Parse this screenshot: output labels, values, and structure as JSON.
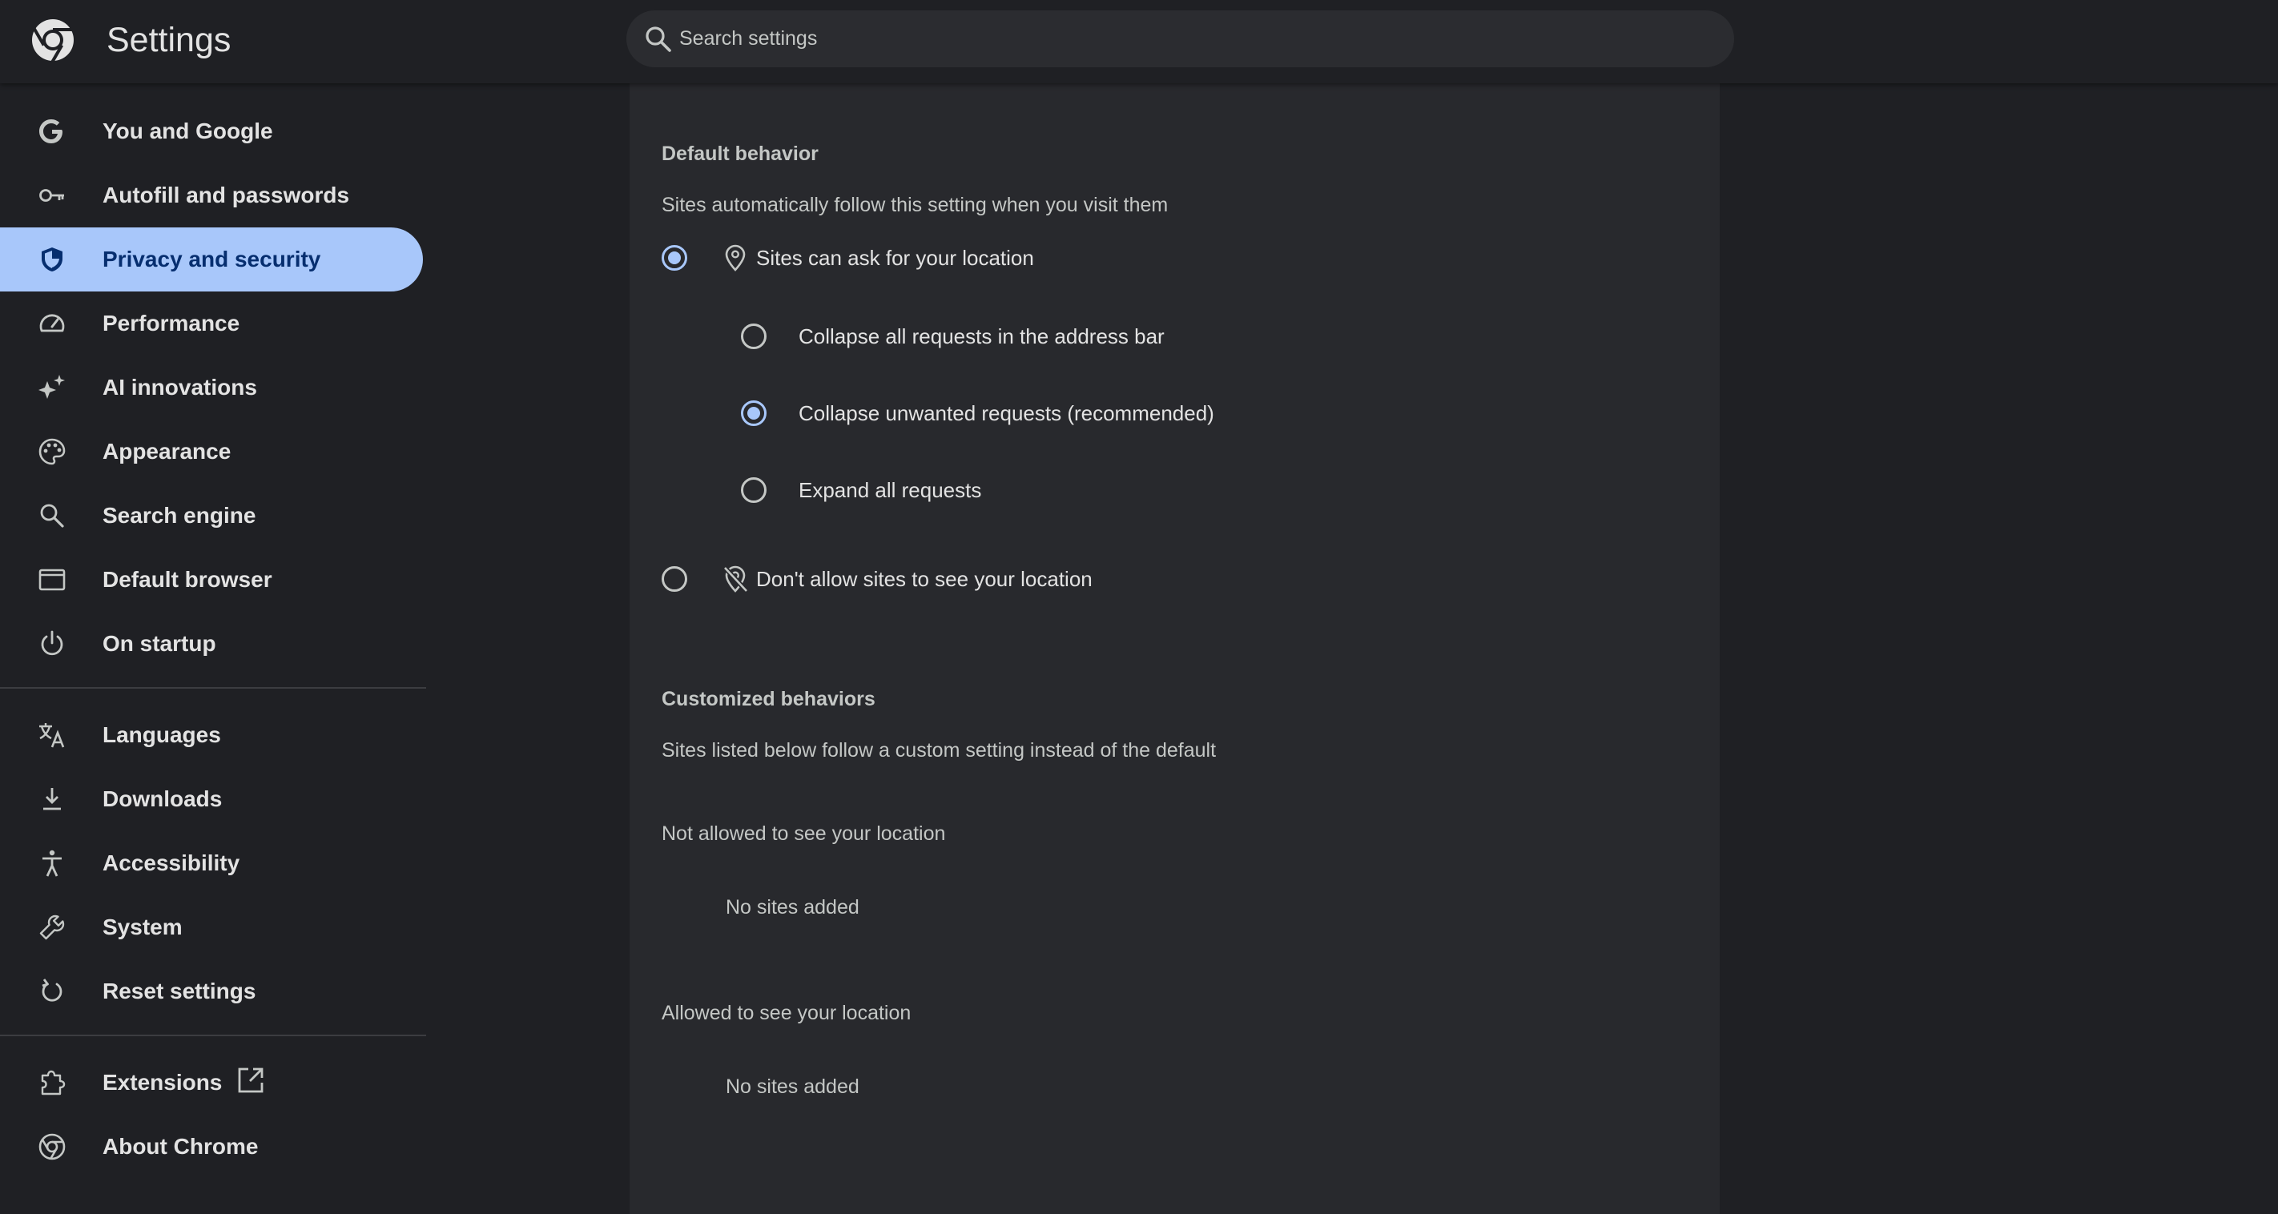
{
  "header": {
    "title": "Settings",
    "search_placeholder": "Search settings"
  },
  "sidebar": {
    "items": [
      {
        "label": "You and Google",
        "icon": "google-g-icon"
      },
      {
        "label": "Autofill and passwords",
        "icon": "key-icon"
      },
      {
        "label": "Privacy and security",
        "icon": "shield-icon",
        "active": true
      },
      {
        "label": "Performance",
        "icon": "speedometer-icon"
      },
      {
        "label": "AI innovations",
        "icon": "sparkle-icon"
      },
      {
        "label": "Appearance",
        "icon": "palette-icon"
      },
      {
        "label": "Search engine",
        "icon": "search-icon"
      },
      {
        "label": "Default browser",
        "icon": "browser-window-icon"
      },
      {
        "label": "On startup",
        "icon": "power-icon"
      },
      {
        "label": "Languages",
        "icon": "translate-icon"
      },
      {
        "label": "Downloads",
        "icon": "download-icon"
      },
      {
        "label": "Accessibility",
        "icon": "accessibility-icon"
      },
      {
        "label": "System",
        "icon": "wrench-icon"
      },
      {
        "label": "Reset settings",
        "icon": "reset-icon"
      },
      {
        "label": "Extensions",
        "icon": "puzzle-icon"
      },
      {
        "label": "About Chrome",
        "icon": "chrome-icon"
      }
    ]
  },
  "main": {
    "default_behavior": {
      "title": "Default behavior",
      "description": "Sites automatically follow this setting when you visit them",
      "options": [
        {
          "label": "Sites can ask for your location",
          "checked": true
        },
        {
          "label": "Collapse all requests in the address bar",
          "checked": false
        },
        {
          "label": "Collapse unwanted requests (recommended)",
          "checked": true
        },
        {
          "label": "Expand all requests",
          "checked": false
        },
        {
          "label": "Don't allow sites to see your location",
          "checked": false
        }
      ]
    },
    "customized_behaviors": {
      "title": "Customized behaviors",
      "description": "Sites listed below follow a custom setting instead of the default",
      "not_allowed": {
        "title": "Not allowed to see your location",
        "empty": "No sites added"
      },
      "allowed": {
        "title": "Allowed to see your location",
        "empty": "No sites added"
      }
    }
  },
  "colors": {
    "background": "#1f2024",
    "panel": "#28292d",
    "accent": "#a8c7fa",
    "active_text": "#062e6f"
  }
}
